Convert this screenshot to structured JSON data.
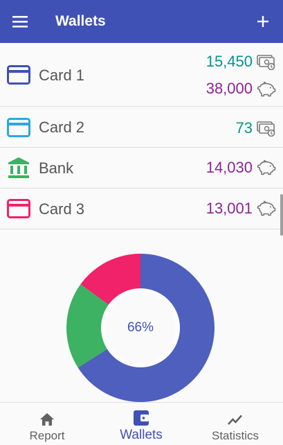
{
  "app": {
    "title": "Wallets"
  },
  "colors": {
    "primary": "#3f51b5",
    "teal": "#00968f",
    "purple": "#8e2494",
    "green": "#3cb262",
    "pink": "#f0226a",
    "sky": "#29a8e0"
  },
  "wallets": [
    {
      "name": "Card 1",
      "icon": "credit-card-icon",
      "color": "#3f51b5",
      "amounts": [
        {
          "value": "15,450",
          "kind": "cash-icon"
        },
        {
          "value": "38,000",
          "kind": "piggy-bank-icon"
        }
      ]
    },
    {
      "name": "Card 2",
      "icon": "credit-card-icon",
      "color": "#29a8e0",
      "amounts": [
        {
          "value": "73",
          "kind": "cash-icon"
        }
      ]
    },
    {
      "name": "Bank",
      "icon": "bank-icon",
      "color": "#3cb262",
      "amounts": [
        {
          "value": "14,030",
          "kind": "piggy-bank-icon"
        }
      ]
    },
    {
      "name": "Card 3",
      "icon": "credit-card-icon",
      "color": "#f0226a",
      "amounts": [
        {
          "value": "13,001",
          "kind": "piggy-bank-icon"
        }
      ]
    }
  ],
  "chart_data": {
    "type": "pie",
    "center_label": "66%",
    "slices": [
      {
        "value": 66,
        "color": "#4f5fbd"
      },
      {
        "value": 19,
        "color": "#3cb262"
      },
      {
        "value": 15,
        "color": "#f0226a"
      }
    ]
  },
  "nav": {
    "report": "Report",
    "wallets": "Wallets",
    "statistics": "Statistics"
  }
}
